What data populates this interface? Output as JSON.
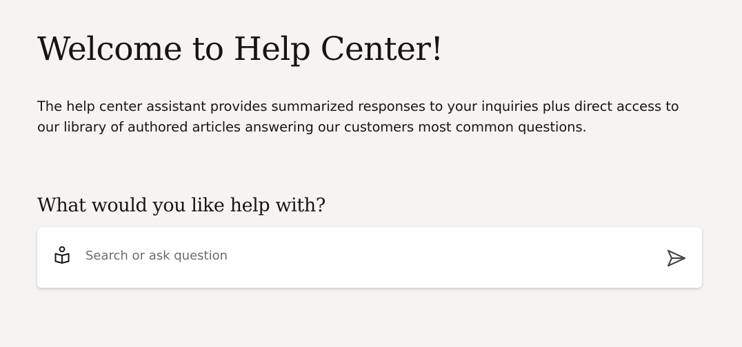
{
  "page": {
    "title": "Welcome to Help Center!",
    "intro": "The help center assistant provides summarized responses to your inquiries plus direct access to our library of authored articles answering our customers most common questions.",
    "prompt": "What would you like help with?"
  },
  "search": {
    "placeholder": "Search or ask question",
    "value": "",
    "leading_icon": "assistant-book-icon",
    "send_icon": "send-icon"
  },
  "colors": {
    "background": "#f5f4f2",
    "text": "#161513",
    "card": "#ffffff",
    "placeholder": "#6f6c69",
    "send_icon": "#4a4744"
  }
}
